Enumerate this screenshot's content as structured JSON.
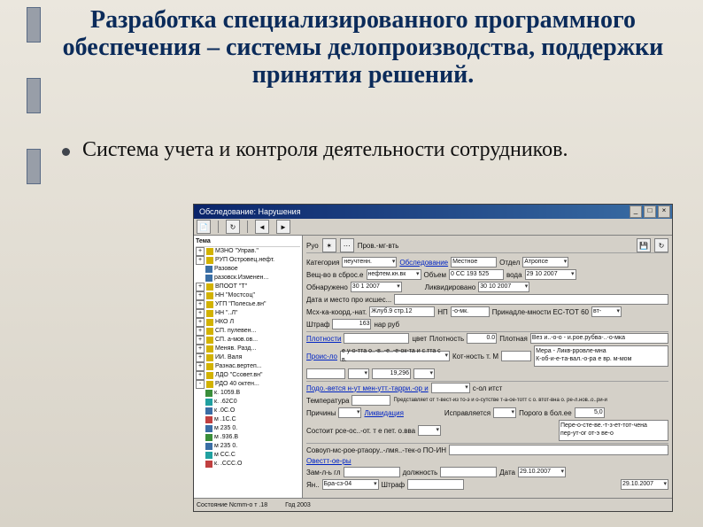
{
  "title": "Разработка специализированного программного обеспечения – системы делопроизводства, поддержки принятия решений.",
  "bullet": "Система учета и контроля деятельности сотрудников.",
  "app": {
    "window_title": "Обследование: Нарушения",
    "tree_header": "Тема",
    "tree_items": [
      {
        "pm": "+",
        "ic": "y",
        "label": "МЗНО \"Управ.\""
      },
      {
        "pm": "+",
        "ic": "y",
        "label": "РУП Островец.нефт."
      },
      {
        "pm": "",
        "ic": "b",
        "label": "Разовое"
      },
      {
        "pm": "",
        "ic": "b",
        "label": "разовск.Изменен..."
      },
      {
        "pm": "+",
        "ic": "y",
        "label": "ВПООТ \"Т\""
      },
      {
        "pm": "+",
        "ic": "y",
        "label": "НН \"Мостсоц\""
      },
      {
        "pm": "+",
        "ic": "y",
        "label": "УГП \"Полесье.вн\""
      },
      {
        "pm": "+",
        "ic": "y",
        "label": "НН \"..Л\""
      },
      {
        "pm": "+",
        "ic": "y",
        "label": "НКО Л"
      },
      {
        "pm": "+",
        "ic": "y",
        "label": "СП. пулевен..."
      },
      {
        "pm": "+",
        "ic": "y",
        "label": "СП. а-мов.ов..."
      },
      {
        "pm": "+",
        "ic": "y",
        "label": "Меняв. Разд..."
      },
      {
        "pm": "+",
        "ic": "y",
        "label": "ИИ. Валя"
      },
      {
        "pm": "+",
        "ic": "y",
        "label": "Разнас.вертеп..."
      },
      {
        "pm": "+",
        "ic": "y",
        "label": "ЛДО \"Ссовет.вн\""
      },
      {
        "pm": "-",
        "ic": "y",
        "label": "РДО 40 октен..."
      },
      {
        "pm": "",
        "ic": "g",
        "label": "к. 1059.В"
      },
      {
        "pm": "",
        "ic": "c",
        "label": "к. .62С0"
      },
      {
        "pm": "",
        "ic": "b",
        "label": "к .0С.О"
      },
      {
        "pm": "",
        "ic": "r",
        "label": "м .1С.С"
      },
      {
        "pm": "",
        "ic": "b",
        "label": "м 235 0."
      },
      {
        "pm": "",
        "ic": "g",
        "label": "м .936.В"
      },
      {
        "pm": "",
        "ic": "b",
        "label": "м 235 0."
      },
      {
        "pm": "",
        "ic": "c",
        "label": "м СС.С"
      },
      {
        "pm": "",
        "ic": "r",
        "label": "к. .ССС.О"
      }
    ],
    "toolbar_items": [
      "file",
      "refresh",
      "prev",
      "next"
    ],
    "form": {
      "label_category": "Категория",
      "value_category": "неучтенн.",
      "label_obsled": "Обследование",
      "value_obsled": "Местное",
      "label_otdel": "Отдел",
      "value_otdel": "Атропсе",
      "label_veshchestvo": "Вещ-во в сброс.е",
      "value_veshchestvo": "нефтем.кн.вк",
      "label_obem": "Объем",
      "value_obem": "0 СС 193 525",
      "label_voda": "вода",
      "value_voda": "29 10 2007",
      "label_obnaruzheno": "Обнаружено",
      "value_obnaruzheno": "30 1 2007",
      "label_likvid": "Ликвидировано",
      "value_likvid": "30 10 2007",
      "label_data_mesto": "Дата и место про исшес...",
      "label_koord": "Мсх-ка-коорд.-нат.",
      "value_koord": "Жлуб.9 стр.12",
      "label_np": "НП",
      "value_np": "-о-мк.",
      "label_prinad": "Принадле-мности ЕС-ТОТ 60",
      "label_shtraf": "Штраф",
      "value_shtraf": "163",
      "label_nar_rub": "нар руб",
      "label_plotnost": "Плотности",
      "label_color": "цвет",
      "label_plotnost2": "Плотность",
      "value_plotnost2": "0.0",
      "label_plotnaya": "Плотная",
      "value_plotnaya": "Вез и..-о-о - и.рое.рубва-..-о-мка",
      "label_proishozh": "Проис-ло",
      "value_proishozh": "е у-о-тта о..-в..-е..-е-ок-та и с.тта с в.",
      "label_kotnost": "Кот-ность т. М",
      "label_mera": "Мера - Ликв-рровле-мна",
      "label_mera2": "К-об-и-е-та-вал.-о-ра е вр. м-мом",
      "value_num": "19,296",
      "label_pod_tovar": "Подо.-вется н-ут мен-утт.-тарри.-ор и",
      "label_ck": "с-ол итст",
      "label_tempera": "Температура",
      "label_predst": "Представляет от т-вест-из то-э и о-сутстве т-а-ое-тотт с о. втот-вна о. ре-л.нов..о..ри-и",
      "label_prichiny": "Причины",
      "label_likv": "Ликвидация",
      "label_ispravlyaetsya": "Исправляется",
      "label_sostoit": "Состоит рсе-ос..-от. т е пет. о.вва",
      "label_porog": "Порого в бол.ее",
      "value_porog": "5,0",
      "label_per_otchest": "Пере-о-сте-ве.-т-з-ет-тот-чена",
      "label_per_kit": "пер-ут-ог от-э ве-о",
      "label_covey": "Совоуп-мс-рое-ртаору..-лмя..-тек-о ПО-ИН",
      "label_ovsetst": "Овестт-ое-ры",
      "label_zamlus": "Зам-л-ь гл",
      "label_dolzhnost": "должность",
      "label_data": "Дата",
      "value_data": "29.10.2007",
      "label_yan": "Ян..",
      "value_yan": "Бра-cз-04",
      "label_shtraf2": "Штраф",
      "value_date2": "29.10.2007"
    },
    "status_left": "Состояние Ncmm-о т .18",
    "status_right": "Год 2003"
  }
}
